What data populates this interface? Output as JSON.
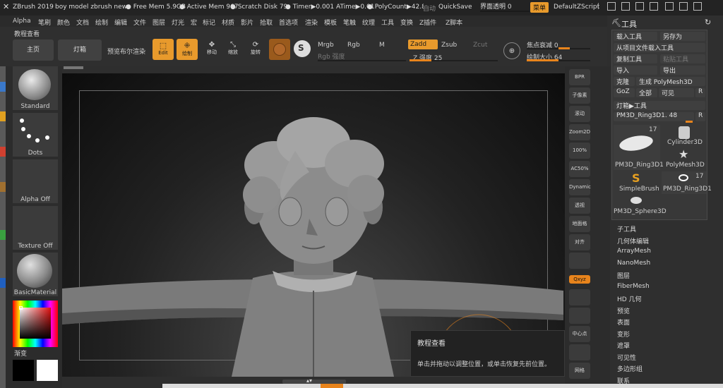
{
  "title_bar": {
    "app": "ZBrush 2019",
    "document": "boy model zbrush new",
    "free_mem": "● Free Mem 5.9GB",
    "active_mem": "● Active Mem 967",
    "scratch": "● Scratch Disk 79",
    "timer": "● Timer▶0.001 ATime▶0.01",
    "polycount": "● PolyCount▶42.87",
    "auto": "自动",
    "quicksave": "QuickSave",
    "interface_transparency": "界面透明 0",
    "menu": "菜单",
    "script": "DefaultZScript"
  },
  "menu_items": [
    "Alpha",
    "笔刷",
    "颜色",
    "文档",
    "绘制",
    "编辑",
    "文件",
    "图层",
    "灯光",
    "宏",
    "标记",
    "材质",
    "影片",
    "拾取",
    "首选项",
    "渲染",
    "模板",
    "笔触",
    "纹理",
    "工具",
    "变换",
    "Z插件",
    "Z脚本"
  ],
  "toolbar": {
    "tutorial": "教程查看",
    "home": "主页",
    "lightbox": "灯箱",
    "preview_bool": "预览布尔渲染",
    "edit": "Edit",
    "draw": "绘制",
    "move": "移动",
    "scale": "缩放",
    "rotate": "旋转",
    "mrgb": "Mrgb",
    "rgb": "Rgb",
    "m": "M",
    "zadd": "Zadd",
    "zsub": "Zsub",
    "zcut": "Zcut",
    "rgb_intensity": "Rgb 强度",
    "z_intensity": "Z 强度 25",
    "focal_shift": "焦点衰减 0",
    "draw_size": "绘制大小 64",
    "z_intensity_value": 25,
    "focal_shift_value": 0,
    "draw_size_value": 64
  },
  "left_shelf": {
    "standard": "Standard",
    "dots": "Dots",
    "alpha_off": "Alpha Off",
    "texture_off": "Texture Off",
    "material": "BasicMaterial",
    "gradient": "渐变"
  },
  "right_tools": [
    "BPR",
    "子像素",
    "滚动",
    "Zoom2D",
    "100%",
    "AC50%",
    "Dynamic",
    "透视",
    "地面格",
    "对齐",
    "",
    "Qxyz",
    "",
    "",
    "中心点",
    "",
    "网格"
  ],
  "tool_panel": {
    "title": "工具",
    "load": "载入工具",
    "save_as": "另存为",
    "load_project": "从项目文件载入工具",
    "copy": "复制工具",
    "paste": "粘贴工具",
    "import": "导入",
    "export": "导出",
    "clone": "克隆",
    "make_polymesh": "生成 PolyMesh3D",
    "goz": "GoZ",
    "all": "全部",
    "visible": "可见",
    "r": "R",
    "lightbox_tool": "灯箱▶工具",
    "current_tool": "PM3D_Ring3D1. 48",
    "thumbs": [
      {
        "name": "PM3D_Ring3D1",
        "badge": "17"
      },
      {
        "name": "Cylinder3D",
        "badge": ""
      },
      {
        "name": "PolyMesh3D",
        "badge": ""
      },
      {
        "name": "SimpleBrush",
        "badge": ""
      },
      {
        "name": "PM3D_Ring3D1",
        "badge": "17"
      },
      {
        "name": "PM3D_Sphere3D",
        "badge": ""
      }
    ],
    "subpalettes": [
      "子工具",
      "几何体编辑",
      "ArrayMesh",
      "NanoMesh",
      "图层",
      "FiberMesh",
      "HD 几何",
      "预览",
      "表面",
      "变形",
      "遮罩",
      "可见性",
      "多边形组",
      "联系"
    ]
  },
  "tooltip": {
    "title": "教程查看",
    "body": "单击并拖动以调整位置，或单击恢复先前位置。"
  },
  "colors": {
    "accent": "#e8841c",
    "bg": "#2e2e2e"
  }
}
